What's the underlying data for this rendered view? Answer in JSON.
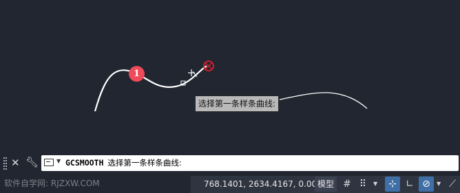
{
  "drawing": {
    "badge_number": "1",
    "tooltip_text": "选择第一条样条曲线:"
  },
  "command_line": {
    "command": "GCSMOOTH",
    "prompt": "选择第一条样条曲线:"
  },
  "status_bar": {
    "watermark": "软件自学网: RJZXW.COM",
    "coordinates": "768.1401, 2634.4167, 0.0000",
    "model_label": "模型"
  },
  "icons": {
    "close": "close-icon",
    "customize": "wrench-icon",
    "grid": "grid-icon",
    "snap": "snap-icon",
    "infer": "infer-constraints-icon",
    "ortho": "ortho-icon",
    "polar": "polar-tracking-icon",
    "osnap": "object-snap-icon"
  },
  "colors": {
    "background": "#212630",
    "badge": "#ee4a5a",
    "active": "#3f6fa5",
    "marker": "#d01f2b"
  }
}
